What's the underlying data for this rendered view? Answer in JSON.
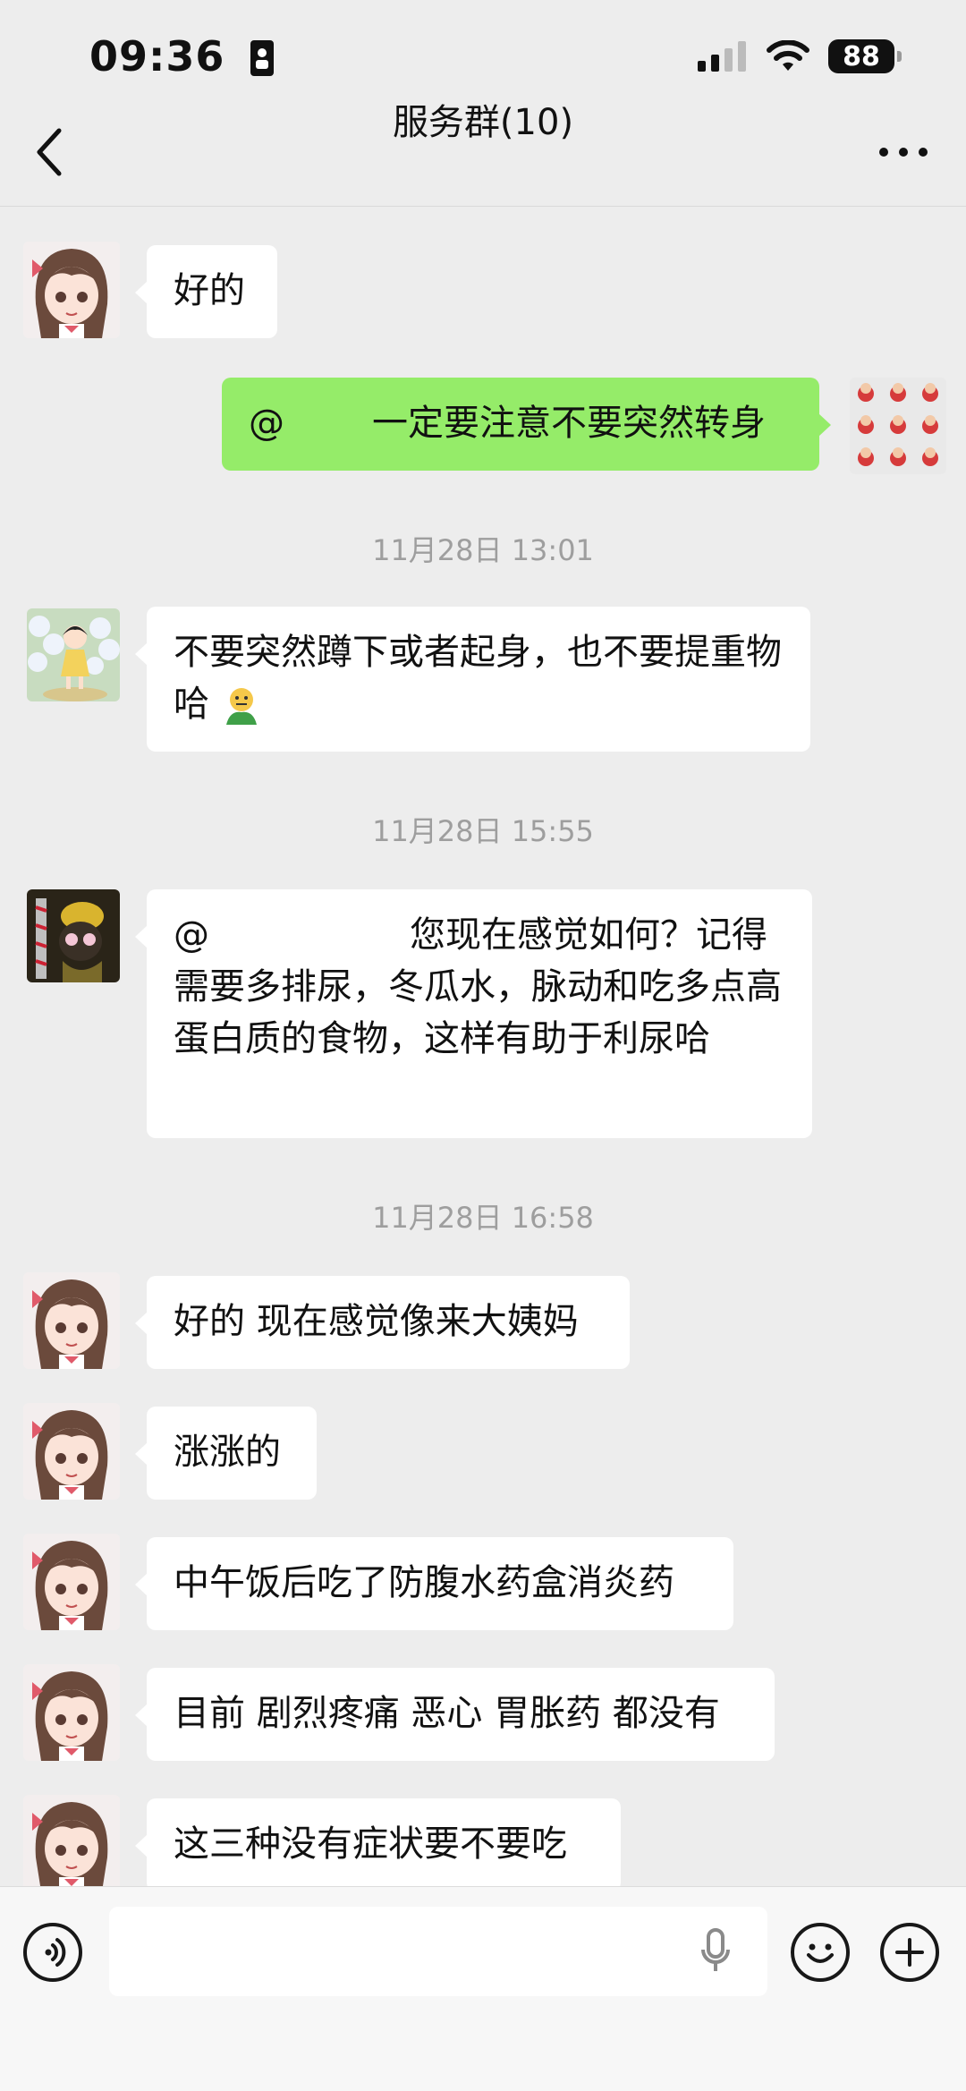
{
  "status_bar": {
    "time": "09:36",
    "battery": "88"
  },
  "header": {
    "title": "服务群(10)"
  },
  "messages": [
    {
      "text": "好的"
    },
    {
      "at": "@",
      "text": "一定要注意不要突然转身"
    },
    {
      "timestamp": "11月28日 13:01"
    },
    {
      "text": "不要突然蹲下或者起身，也不要提重物哈"
    },
    {
      "timestamp": "11月28日 15:55"
    },
    {
      "at": "@",
      "text": "您现在感觉如何？记得需要多排尿，冬瓜水，脉动和吃多点高蛋白质的食物，这样有助于利尿哈"
    },
    {
      "timestamp": "11月28日 16:58"
    },
    {
      "text": "好的 现在感觉像来大姨妈"
    },
    {
      "text": "涨涨的"
    },
    {
      "text": "中午饭后吃了防腹水药盒消炎药"
    },
    {
      "text": "目前 剧烈疼痛 恶心 胃胀药 都没有"
    },
    {
      "text": "这三种没有症状要不要吃"
    }
  ],
  "icons": {
    "back": "chevron-left-icon",
    "more": "more-dots-icon",
    "voice": "voice-icon",
    "mic": "mic-icon",
    "emoji": "emoji-icon",
    "plus": "plus-icon"
  },
  "colors": {
    "bubble_self": "#95ec69",
    "bubble_other": "#ffffff",
    "background": "#ededed"
  }
}
